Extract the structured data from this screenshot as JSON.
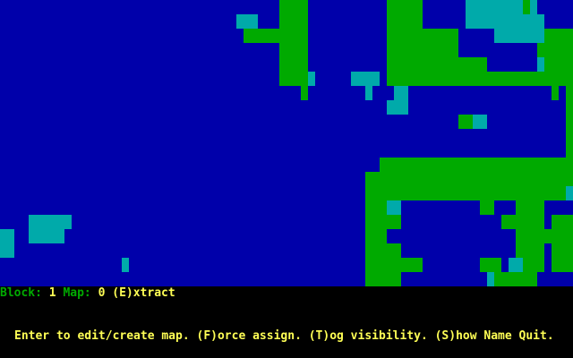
{
  "status": {
    "block_label": "Block:",
    "block_value": "1",
    "map_label": "Map:",
    "map_value": "0",
    "extract_label": "(E)xtract"
  },
  "prompt": {
    "text": "Enter to edit/create map. (F)orce assign. (T)og visibility. (S)how Name Quit."
  },
  "colors": {
    "water": "#0000aa",
    "land": "#00aa00",
    "shallow": "#00aaaa",
    "text_yellow": "#ffff55",
    "text_green": "#00aa00",
    "background": "#000000"
  }
}
